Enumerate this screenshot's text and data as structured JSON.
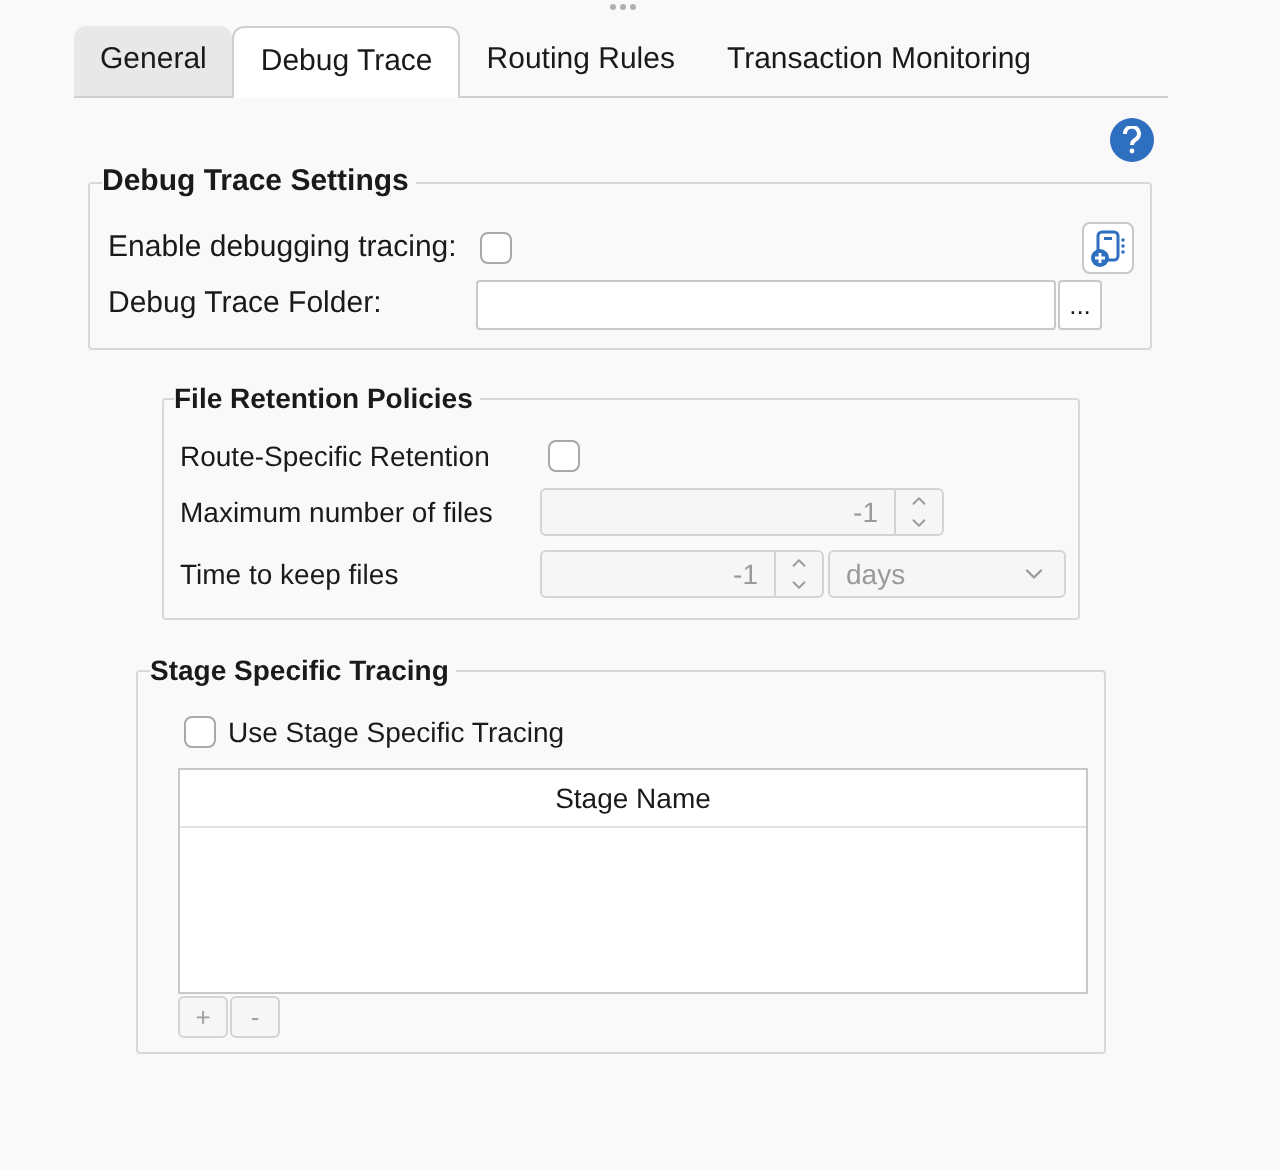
{
  "tabs": [
    {
      "label": "General",
      "selected": false
    },
    {
      "label": "Debug Trace",
      "selected": true
    },
    {
      "label": "Routing Rules",
      "selected": false
    },
    {
      "label": "Transaction Monitoring",
      "selected": false
    }
  ],
  "debug_trace_settings": {
    "title": "Debug Trace Settings",
    "enable_label": "Enable debugging tracing:",
    "enable_checked": false,
    "folder_label": "Debug Trace Folder:",
    "browse_button": "..."
  },
  "file_retention": {
    "title": "File Retention Policies",
    "route_label": "Route-Specific Retention",
    "route_checked": false,
    "disabled": true,
    "max_files_label": "Maximum number of files",
    "max_files_value": "-1",
    "time_label": "Time to keep files",
    "time_value": "-1",
    "time_unit": "days"
  },
  "stage_tracing": {
    "title": "Stage Specific Tracing",
    "use_label": "Use Stage Specific Tracing",
    "use_checked": false,
    "table": {
      "columns": [
        "Stage Name"
      ]
    },
    "buttons": [
      {
        "label": "+",
        "disabled": true
      },
      {
        "label": "-",
        "disabled": true
      }
    ]
  }
}
